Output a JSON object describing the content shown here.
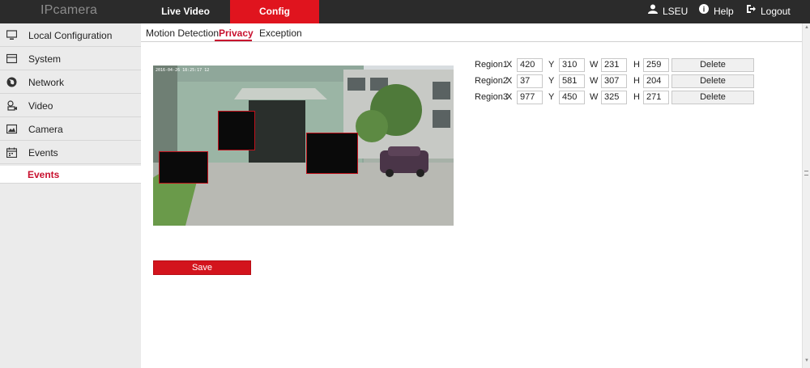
{
  "header": {
    "logo": "IPcamera",
    "tabs": [
      {
        "label": "Live Video"
      },
      {
        "label": "Config"
      }
    ],
    "user": "LSEU",
    "help": "Help",
    "logout": "Logout"
  },
  "sidebar": {
    "items": [
      {
        "label": "Local Configuration",
        "icon": "monitor-icon"
      },
      {
        "label": "System",
        "icon": "system-icon"
      },
      {
        "label": "Network",
        "icon": "globe-icon"
      },
      {
        "label": "Video",
        "icon": "video-icon"
      },
      {
        "label": "Camera",
        "icon": "image-icon"
      },
      {
        "label": "Events",
        "icon": "calendar-icon"
      }
    ],
    "selected_sub": "Events"
  },
  "subtabs": [
    {
      "label": "Motion Detection"
    },
    {
      "label": "Privacy"
    },
    {
      "label": "Exception"
    }
  ],
  "video": {
    "osd": "2016-04-26 18:25:17 12"
  },
  "regions": [
    {
      "label": "Region1",
      "x_label": "X",
      "x": "420",
      "y_label": "Y",
      "y": "310",
      "w_label": "W",
      "w": "231",
      "h_label": "H",
      "h": "259",
      "delete": "Delete"
    },
    {
      "label": "Region2",
      "x_label": "X",
      "x": "37",
      "y_label": "Y",
      "y": "581",
      "w_label": "W",
      "w": "307",
      "h_label": "H",
      "h": "204",
      "delete": "Delete"
    },
    {
      "label": "Region3",
      "x_label": "X",
      "x": "977",
      "y_label": "Y",
      "y": "450",
      "w_label": "W",
      "w": "325",
      "h_label": "H",
      "h": "271",
      "delete": "Delete"
    }
  ],
  "save_label": "Save",
  "colors": {
    "accent": "#e0141e",
    "topbar": "#2b2b2b"
  }
}
